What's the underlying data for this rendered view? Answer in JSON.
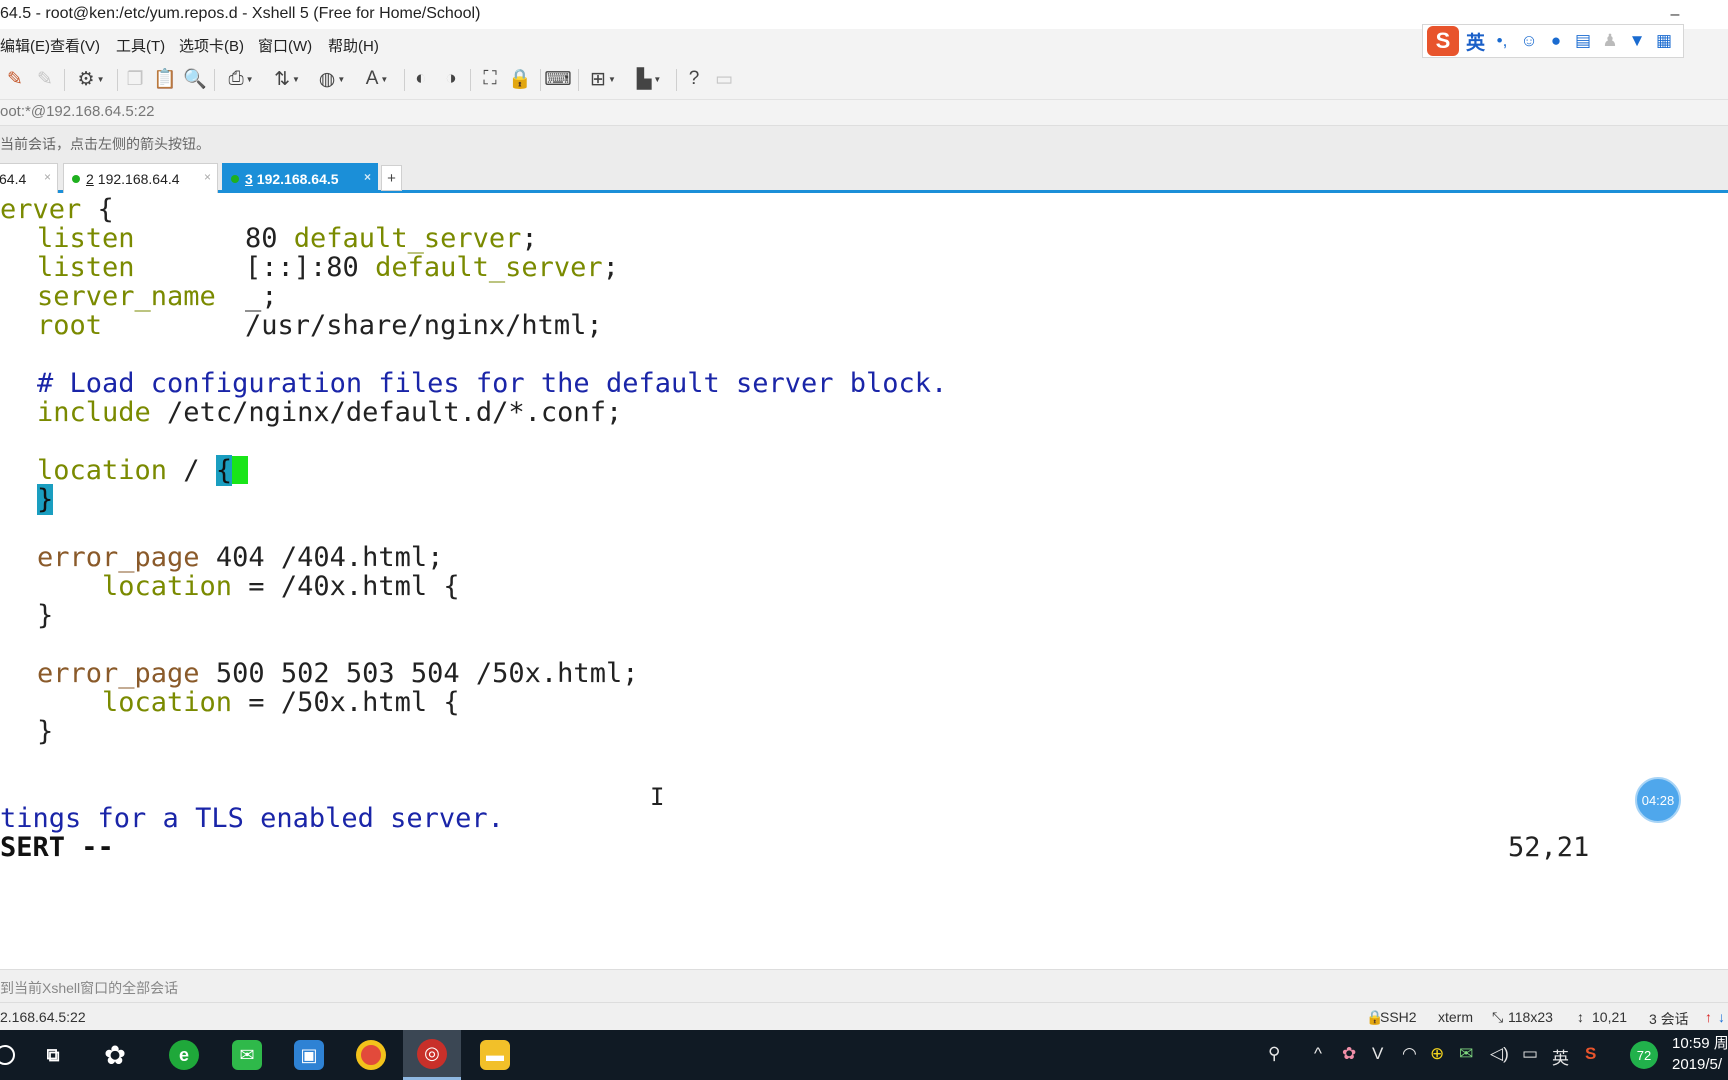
{
  "window": {
    "title": "64.5 - root@ken:/etc/yum.repos.d - Xshell 5 (Free for Home/School)",
    "minimize_glyph": "–"
  },
  "menu": [
    "编辑(E)",
    "查看(V)",
    "工具(T)",
    "选项卡(B)",
    "窗口(W)",
    "帮助(H)"
  ],
  "ime": {
    "logo": "S",
    "lang": "英",
    "punct": "•,",
    "icons": [
      "smile-icon",
      "mic-icon",
      "keyboard-icon",
      "user-icon",
      "shirt-icon",
      "grid-icon"
    ]
  },
  "address": "oot:*@192.168.64.5:22",
  "hint": "当前会话，点击左侧的箭头按钮。",
  "tabs": [
    {
      "num": "",
      "label": "64.4",
      "active": false
    },
    {
      "num": "2",
      "label": "192.168.64.4",
      "active": false
    },
    {
      "num": "3",
      "label": "192.168.64.5",
      "active": true
    }
  ],
  "tab_add": "+",
  "tab_close": "×",
  "terminal": {
    "lines": {
      "l1_a": "erver",
      "l1_b": " {",
      "l2_kw": "listen",
      "l2_v": "80",
      "l2_kw2": "default_server",
      "l2_end": ";",
      "l3_kw": "listen",
      "l3_v": "[::]:80",
      "l3_kw2": "default_server",
      "l3_end": ";",
      "l4_kw": "server_name",
      "l4_v": "_;",
      "l5_kw": "root",
      "l5_v": "/usr/share/nginx/html;",
      "l6": "# Load configuration files for the default server block.",
      "l7_kw": "include",
      "l7_v": " /etc/nginx/default.d/*.conf;",
      "l8_kw": "location",
      "l8_v": " / ",
      "l8_brace": "{",
      "l9_brace": "}",
      "l10_kw": "error_page",
      "l10_v": " 404 /404.html;",
      "l11_kw": "location",
      "l11_v": " = /40x.html {",
      "l12": "}",
      "l13_kw": "error_page",
      "l13_v": " 500 502 503 504 /50x.html;",
      "l14_kw": "location",
      "l14_v": " = /50x.html {",
      "l15": "}",
      "l16": "tings for a TLS enabled server.",
      "mode": "SERT --",
      "position": "52,21"
    },
    "ibeam": "I"
  },
  "timer": "04:28",
  "send_hint": "到当前Xshell窗口的全部会话",
  "statusbar": {
    "host": "2.168.64.5:22",
    "proto": "SSH2",
    "term": "xterm",
    "size": "118x23",
    "cursor": "10,21",
    "sessions": "3 会话"
  },
  "taskbar": {
    "apps": [
      "task-view",
      "xshell-swirl",
      "browser-e",
      "wechat",
      "notes",
      "chrome",
      "xshell",
      "explorer"
    ],
    "tray_lang": "英",
    "battery": "72",
    "time": "10:59 周",
    "date": "2019/5/"
  },
  "colors": {
    "accent": "#1b8fd8",
    "keyword": "#7a8a00",
    "comment": "#1a25a8",
    "cursor": "#19e519"
  }
}
